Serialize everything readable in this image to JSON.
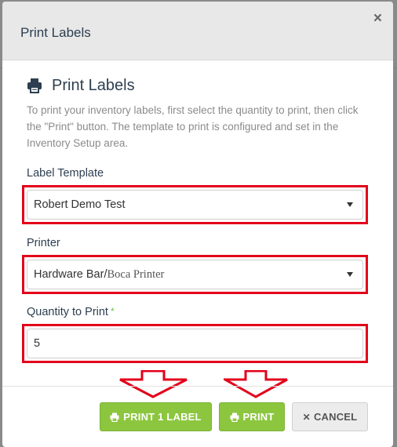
{
  "modal": {
    "title": "Print Labels",
    "close_glyph": "×"
  },
  "section": {
    "heading": "Print Labels",
    "icon": "printer-icon",
    "description": "To print your inventory labels, first select the quantity to print, then click the \"Print\" button. The template to print is configured and set in the Inventory Setup area."
  },
  "fields": {
    "template_label": "Label Template",
    "template_value": "Robert Demo Test",
    "printer_label": "Printer",
    "printer_value_a": "Hardware Bar/",
    "printer_value_b": "Boca Printer",
    "quantity_label": "Quantity to Print",
    "quantity_required": "*",
    "quantity_value": "5"
  },
  "buttons": {
    "print_one": "PRINT 1 LABEL",
    "print": "PRINT",
    "cancel": "CANCEL",
    "cancel_glyph": "✕"
  },
  "colors": {
    "highlight": "#e3001b",
    "primary": "#8cc63f"
  }
}
